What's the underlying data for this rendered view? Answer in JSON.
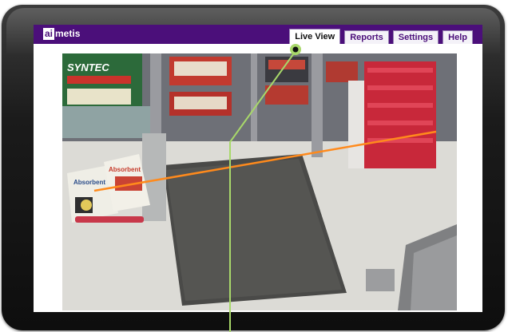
{
  "app": {
    "logo_text": "metis",
    "logo_box_text": "ai",
    "brand_color": "#4b0f7a"
  },
  "tabs": [
    {
      "label": "Live View",
      "active": true
    },
    {
      "label": "Reports",
      "active": false
    },
    {
      "label": "Settings",
      "active": false
    },
    {
      "label": "Help",
      "active": false
    }
  ],
  "video": {
    "sign_text": "SYNTEC",
    "bag_label_1": "Absorbent",
    "bag_label_2": "Absorbent",
    "tripwire_color": "#ff8a1c"
  },
  "callout": {
    "color": "#a8d86a"
  }
}
